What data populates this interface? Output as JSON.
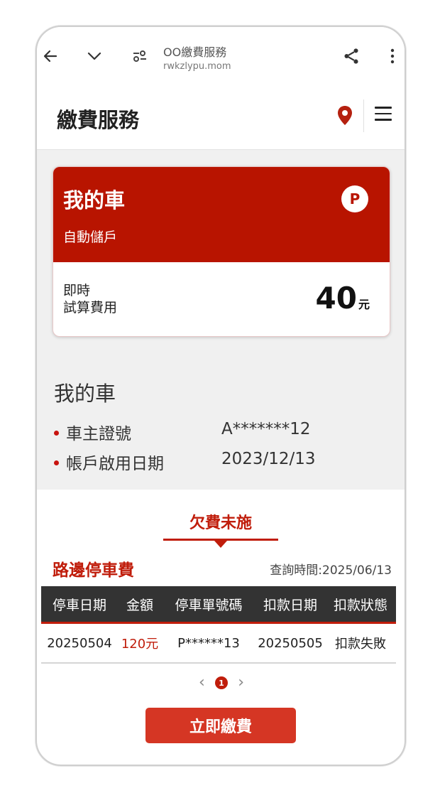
{
  "browser": {
    "title": "OO繳費服務",
    "url": "rwkzlypu.mom",
    "icons": [
      "back-arrow-icon",
      "chevron-down-icon",
      "site-settings-icon",
      "share-icon",
      "more-vert-icon"
    ]
  },
  "header": {
    "title": "繳費服務",
    "icons": [
      "location-pin-icon",
      "hamburger-menu-icon"
    ],
    "accent_color": "#c01d0b"
  },
  "card": {
    "title": "我的車",
    "subtitle": "自動儲戶",
    "badge": "P",
    "fee_label_line1": "即時",
    "fee_label_line2": "試算費用",
    "amount": "40",
    "unit": "元",
    "head_color": "#b81400"
  },
  "info": {
    "title": "我的車",
    "rows": [
      {
        "label": "車主證號",
        "value": "A*******12"
      },
      {
        "label": "帳戶啟用日期",
        "value": "2023/12/13"
      }
    ]
  },
  "tab": {
    "label": "欠費未施"
  },
  "section": {
    "title": "路邊停車費",
    "query_time": "查詢時間:2025/06/13"
  },
  "table": {
    "headers": [
      "停車日期",
      "金額",
      "停車單號碼",
      "扣款日期",
      "扣款狀態"
    ],
    "rows": [
      [
        "20250504",
        "120元",
        "P******13",
        "20250505",
        "扣款失敗"
      ]
    ]
  },
  "pagination": {
    "current": "1",
    "prev": "‹",
    "next": "›"
  },
  "pay_button": {
    "label": "立即繳費",
    "color": "#d53624"
  }
}
